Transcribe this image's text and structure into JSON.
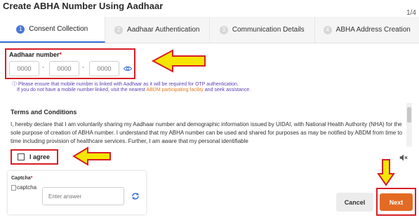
{
  "page": {
    "title": "Create ABHA Number Using Aadhaar",
    "step_counter": "1/4"
  },
  "tabs": [
    {
      "num": "1",
      "label": "Consent Collection",
      "active": true
    },
    {
      "num": "2",
      "label": "Aadhaar Authentication",
      "active": false
    },
    {
      "num": "3",
      "label": "Communication Details",
      "active": false
    },
    {
      "num": "4",
      "label": "ABHA Address Creation",
      "active": false
    }
  ],
  "aadhaar": {
    "label": "Aadhaar number",
    "required_marker": "*",
    "placeholders": [
      "0000",
      "0000",
      "0000"
    ],
    "separator": "-"
  },
  "info": {
    "line1": "Please ensure that mobile number is linked with Aadhaar as it will be required for OTP authentication.",
    "line2_prefix": "If you do not have a mobile number linked, visit the nearest",
    "line2_link": "ABDM participating facility",
    "line2_suffix": "and seek assistance."
  },
  "terms": {
    "title": "Terms and Conditions",
    "text": "I, hereby declare that I am voluntarily sharing my Aadhaar number and demographic information issued by UIDAI, with National Health Authority (NHA) for the sole purpose of creation of ABHA number. I understand that my ABHA number can be used and shared for purposes as may be notified by ABDM from time to time including provision of healthcare services. Further, I am aware that my personal identifiable"
  },
  "agree": {
    "label": "I agree",
    "checked": false
  },
  "captcha": {
    "label": "Captcha",
    "required_marker": "*",
    "image_alt": "captcha",
    "placeholder": "Enter answer"
  },
  "actions": {
    "cancel": "Cancel",
    "next": "Next"
  },
  "colors": {
    "highlight": "#d71f26",
    "arrow": "#f4e600",
    "primary": "#e36a24",
    "tab_accent": "#3b6fd6"
  }
}
